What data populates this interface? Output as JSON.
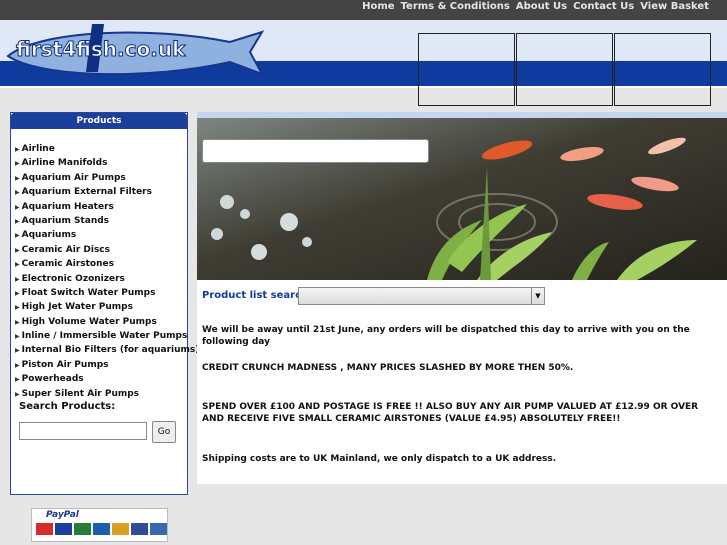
{
  "nav": {
    "links": [
      "Home",
      "Terms & Conditions",
      "About Us",
      "Contact Us",
      "View Basket"
    ]
  },
  "logo": {
    "text": "first4fish.co.uk"
  },
  "sidebar": {
    "title": "Products",
    "items": [
      "Airline",
      "Airline Manifolds",
      "Aquarium Air Pumps",
      "Aquarium External Filters",
      "Aquarium Heaters",
      "Aquarium Stands",
      "Aquariums",
      "Ceramic Air Discs",
      "Ceramic Airstones",
      "Electronic Ozonizers",
      "Float Switch Water Pumps",
      "High Jet Water Pumps",
      "High Volume Water Pumps",
      "Inline / Immersible Water Pumps",
      "Internal Bio Filters (for aquariums)",
      "Piston Air Pumps",
      "Powerheads",
      "Super Silent Air Pumps"
    ],
    "search_label": "Search Products:",
    "search_value": "",
    "go_label": "Go"
  },
  "main": {
    "product_search_label": "Product list search:",
    "selected_option": "",
    "messages": [
      "We will be away until 21st June, any orders will be dispatched this day to arrive with you on the following day",
      "CREDIT CRUNCH MADNESS , MANY PRICES SLASHED BY MORE THEN 50%.",
      "SPEND OVER £100 AND POSTAGE IS FREE !! ALSO BUY ANY AIR PUMP VALUED AT £12.99 OR OVER AND RECEIVE FIVE SMALL CERAMIC AIRSTONES (VALUE £4.95) ABSOLUTELY FREE!!",
      "Shipping costs are to UK Mainland, we only dispatch to a UK address."
    ]
  },
  "paypal": {
    "label": "PayPal"
  },
  "colors": {
    "accent": "#0f3a9e",
    "header_band": "#0f3a9e",
    "topbar": "#444444"
  }
}
